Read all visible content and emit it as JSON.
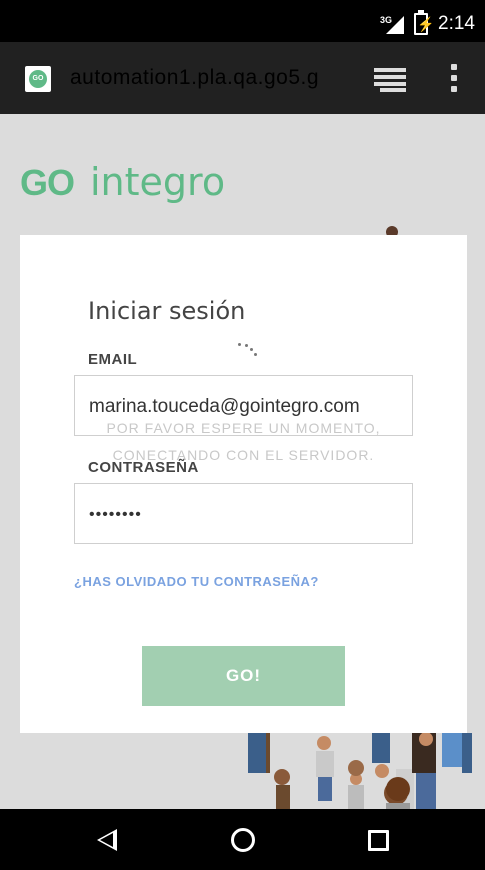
{
  "status_bar": {
    "network": "3G",
    "time": "2:14"
  },
  "browser": {
    "favicon_text": "GO",
    "url": "automation1.pla.qa.go5.g"
  },
  "logo": {
    "go": "GO",
    "integro": "integro"
  },
  "login": {
    "title": "Iniciar sesión",
    "email_label": "EMAIL",
    "email_value": "marina.touceda@gointegro.com",
    "password_label": "CONTRASEÑA",
    "password_value": "••••••••",
    "forgot_link": "¿HAS OLVIDADO TU CONTRASEÑA?",
    "submit_label": "GO!"
  },
  "loading": {
    "line1": "POR FAVOR ESPERE UN MOMENTO,",
    "line2": "CONECTANDO CON EL SERVIDOR."
  },
  "colors": {
    "brand_green": "#5fb987",
    "button_green": "#a2cfb1",
    "link_blue": "#7aa2e0"
  }
}
